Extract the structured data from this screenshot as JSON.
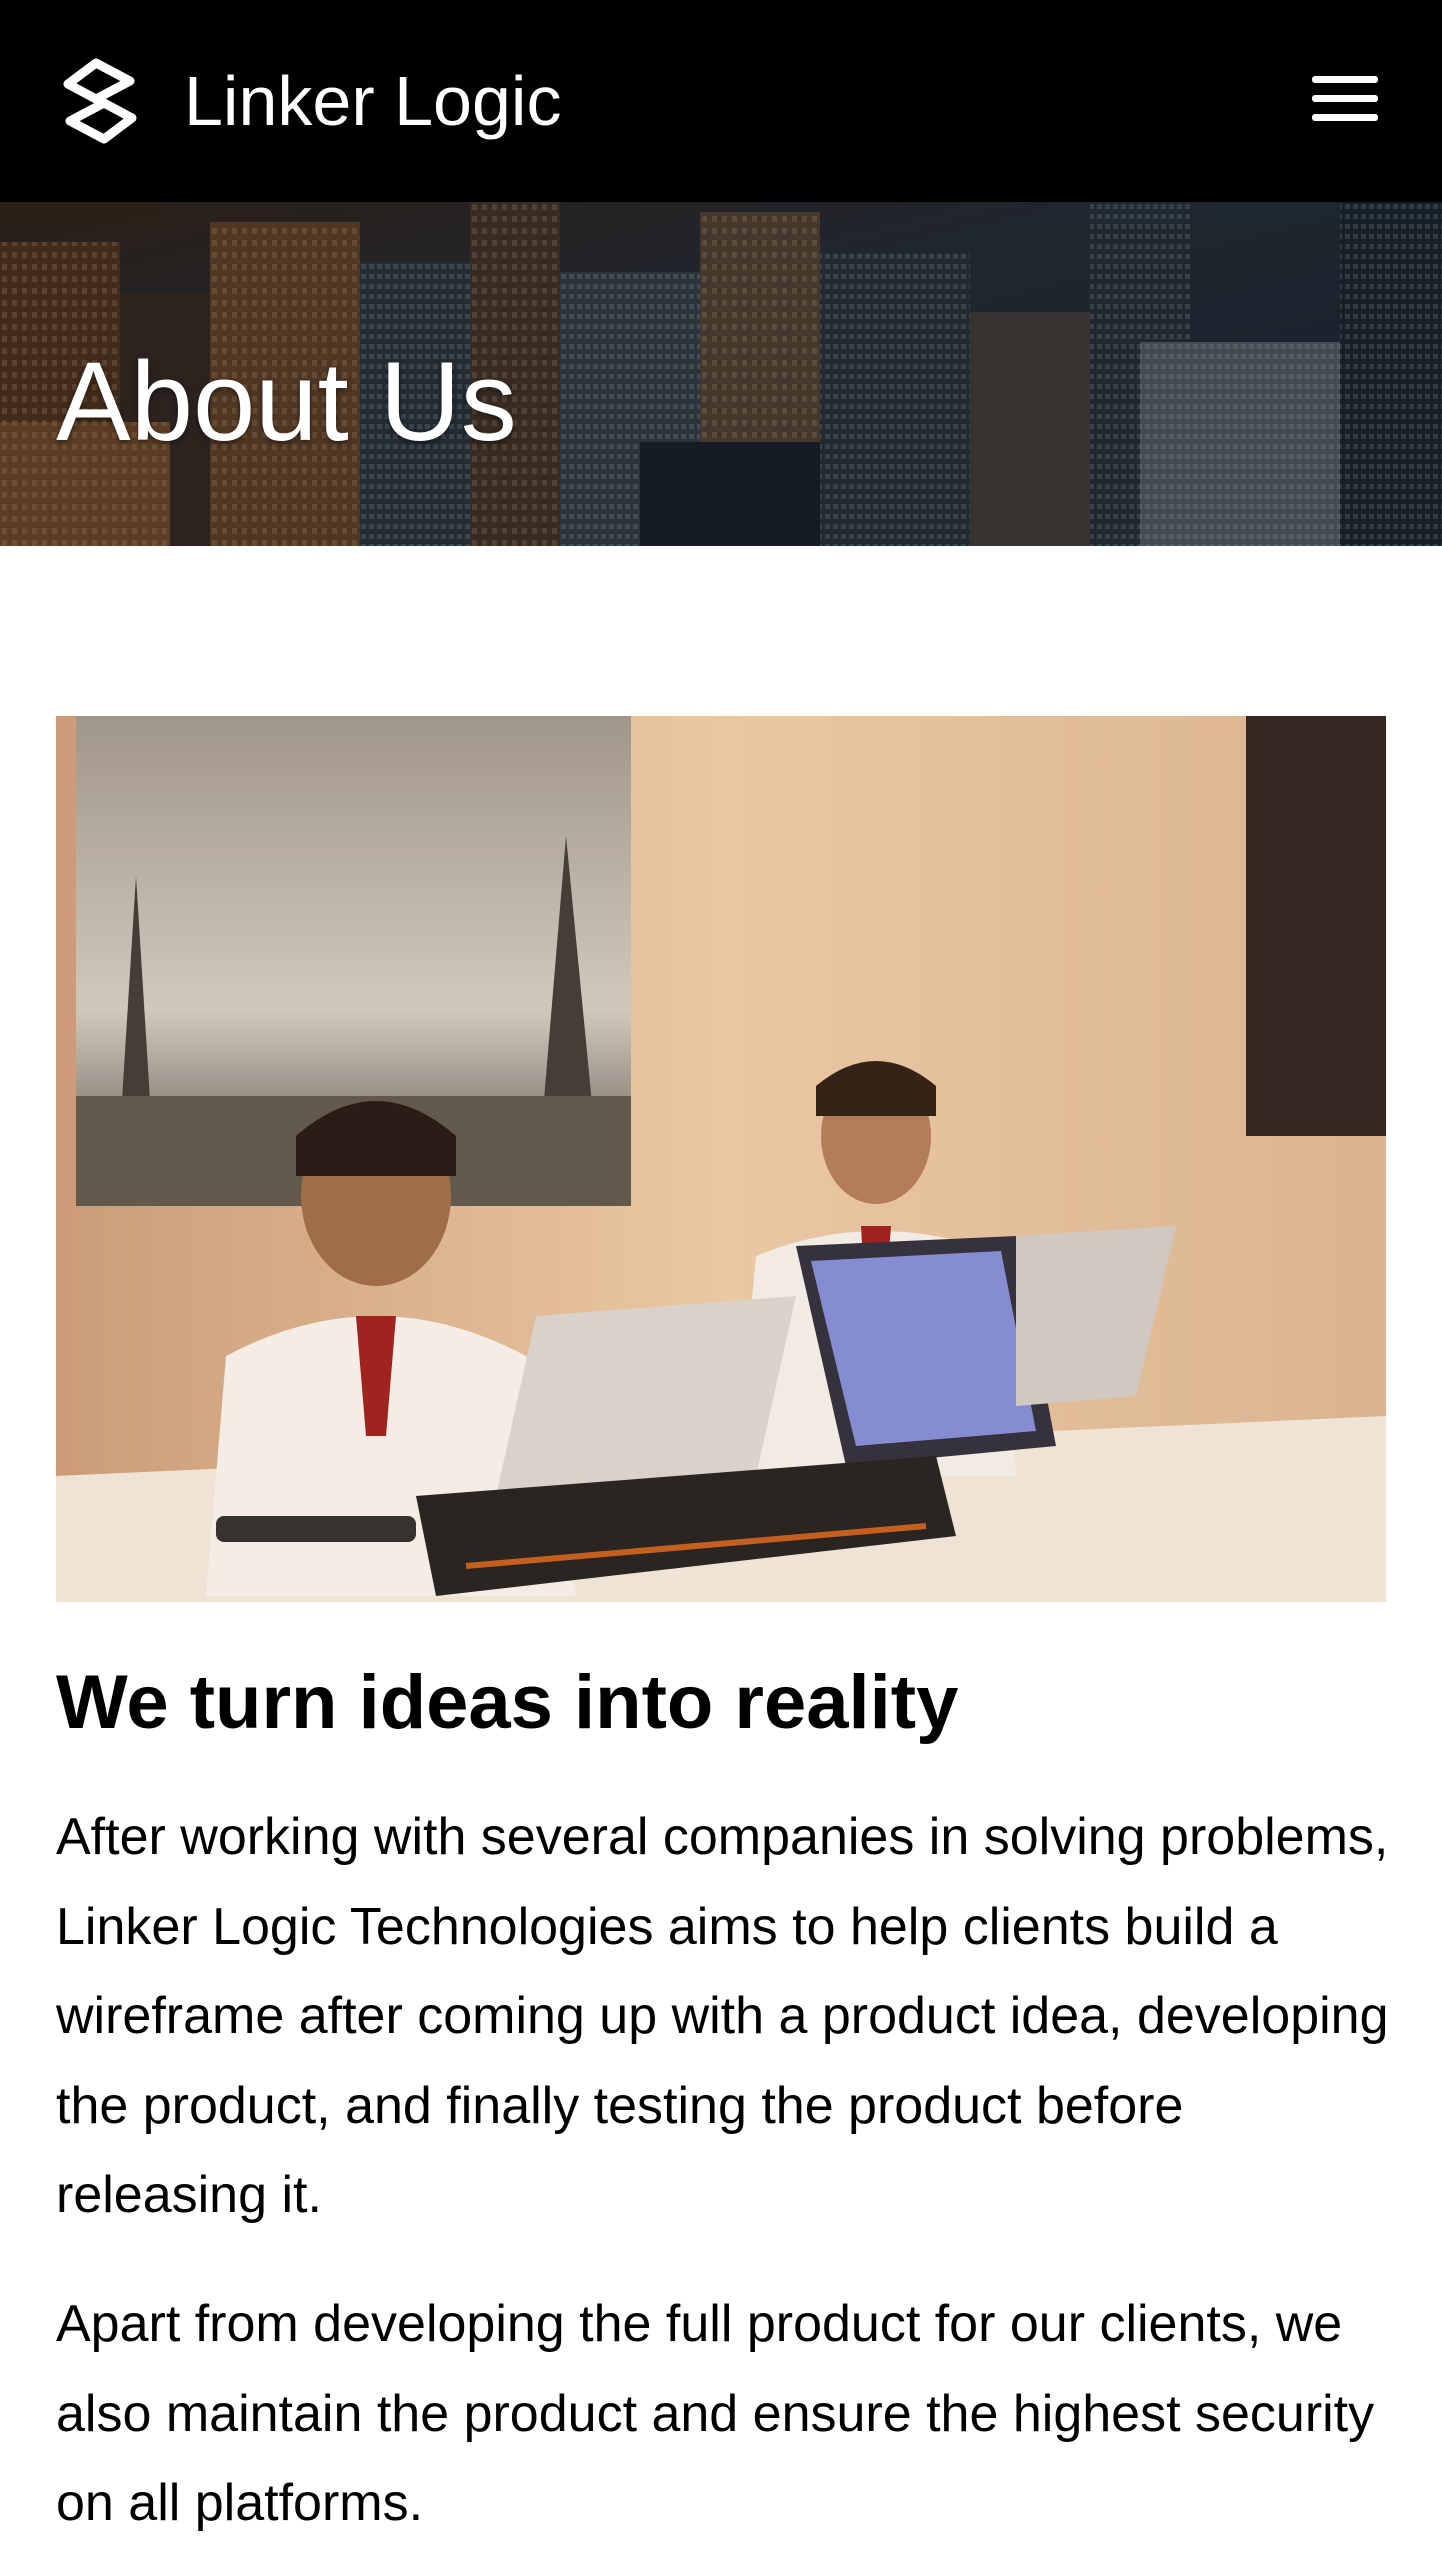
{
  "header": {
    "brand_name": "Linker Logic",
    "logo_icon": "linker-logic-logo-icon",
    "menu_icon": "hamburger-menu-icon",
    "background": "#000000"
  },
  "hero": {
    "title": "About Us",
    "image": "city-skyline-aerial-photo"
  },
  "photo": {
    "image": "team-meeting-photo",
    "description_icon": "photo-icon"
  },
  "content": {
    "heading": "We turn ideas into reality",
    "paragraph_1": "After working with several companies in solving problems, Linker Logic Technologies aims to help clients build a wireframe after coming up with a product idea, developing the product, and finally testing the product before releasing it.",
    "paragraph_2": "Apart from developing the full product for our clients, we also maintain the product and ensure the highest security on all platforms."
  }
}
